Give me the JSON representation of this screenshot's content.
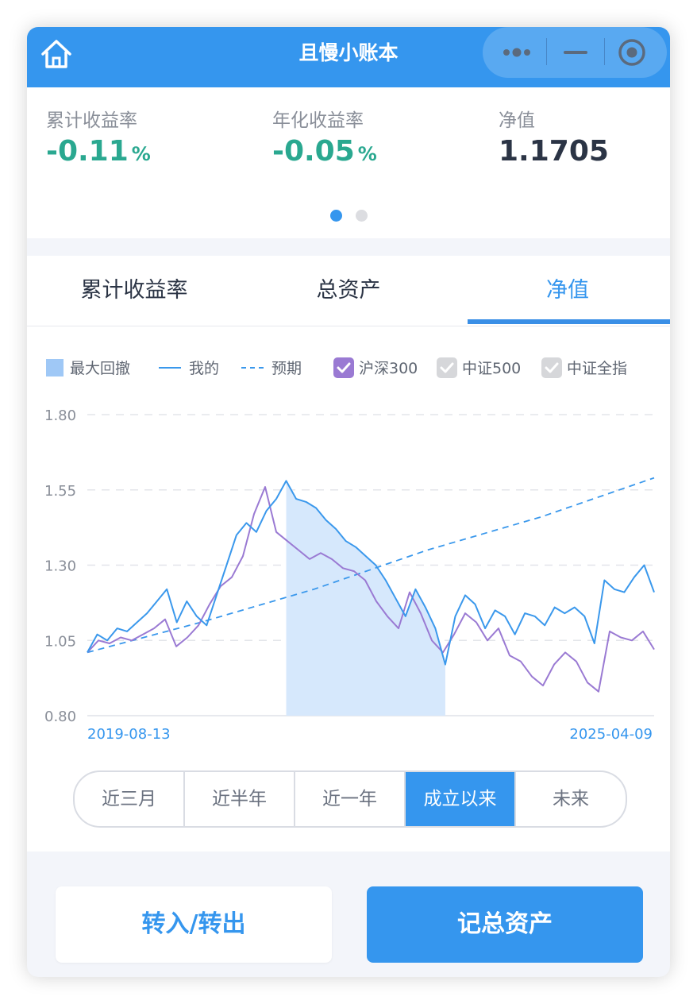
{
  "header": {
    "title": "且慢小账本",
    "home_icon": "home-icon",
    "menu_icons": [
      "more-dots-icon",
      "minimize-icon",
      "close-target-icon"
    ]
  },
  "stats": [
    {
      "label": "累计收益率",
      "value": "-0.11",
      "unit": "%",
      "color": "#2aa890"
    },
    {
      "label": "年化收益率",
      "value": "-0.05",
      "unit": "%",
      "color": "#2aa890"
    },
    {
      "label": "净值",
      "value": "1.1705",
      "unit": "",
      "color": "#2b3445"
    }
  ],
  "pager": {
    "pages": 2,
    "active": 0,
    "active_color": "#3596ee",
    "inactive_color": "#dcdde1"
  },
  "tabs": [
    {
      "label": "累计收益率",
      "active": false
    },
    {
      "label": "总资产",
      "active": false
    },
    {
      "label": "净值",
      "active": true
    }
  ],
  "legend": [
    {
      "label": "最大回撤",
      "kind": "area",
      "color": "#9fc8f6",
      "checked": true
    },
    {
      "label": "我的",
      "kind": "line",
      "color": "#3a98ec",
      "checked": true
    },
    {
      "label": "预期",
      "kind": "dashed",
      "color": "#3a98ec",
      "checked": true
    },
    {
      "label": "沪深300",
      "kind": "checkbox",
      "color": "#9a7ad3",
      "checked": true
    },
    {
      "label": "中证500",
      "kind": "checkbox",
      "color": "#d6d7da",
      "checked": false
    },
    {
      "label": "中证全指",
      "kind": "checkbox",
      "color": "#d6d7da",
      "checked": false
    }
  ],
  "chart_data": {
    "type": "line",
    "y_ticks": [
      "1.80",
      "1.55",
      "1.30",
      "1.05",
      "0.80"
    ],
    "ylim": [
      0.8,
      1.8
    ],
    "x_start_label": "2019-08-13",
    "x_end_label": "2025-04-09",
    "grid": true,
    "legend_position": "top",
    "series": [
      {
        "name": "我的",
        "color": "#3a98ec",
        "style": "solid",
        "values": [
          1.01,
          1.07,
          1.05,
          1.09,
          1.08,
          1.11,
          1.14,
          1.18,
          1.22,
          1.11,
          1.18,
          1.13,
          1.1,
          1.2,
          1.3,
          1.4,
          1.44,
          1.41,
          1.48,
          1.52,
          1.58,
          1.52,
          1.51,
          1.49,
          1.45,
          1.42,
          1.38,
          1.36,
          1.33,
          1.3,
          1.25,
          1.19,
          1.13,
          1.22,
          1.16,
          1.09,
          0.97,
          1.13,
          1.2,
          1.17,
          1.09,
          1.15,
          1.13,
          1.07,
          1.14,
          1.13,
          1.1,
          1.16,
          1.14,
          1.16,
          1.13,
          1.04,
          1.25,
          1.22,
          1.21,
          1.26,
          1.3,
          1.21
        ]
      },
      {
        "name": "沪深300",
        "color": "#9a7ad3",
        "style": "solid",
        "values": [
          1.01,
          1.05,
          1.04,
          1.06,
          1.05,
          1.07,
          1.09,
          1.12,
          1.03,
          1.06,
          1.1,
          1.17,
          1.23,
          1.26,
          1.33,
          1.47,
          1.56,
          1.41,
          1.38,
          1.35,
          1.32,
          1.34,
          1.32,
          1.29,
          1.28,
          1.25,
          1.18,
          1.13,
          1.09,
          1.21,
          1.14,
          1.05,
          1.01,
          1.07,
          1.14,
          1.11,
          1.05,
          1.09,
          1.0,
          0.98,
          0.93,
          0.9,
          0.97,
          1.01,
          0.98,
          0.91,
          0.88,
          1.08,
          1.06,
          1.05,
          1.08,
          1.02
        ]
      },
      {
        "name": "预期",
        "color": "#3a98ec",
        "style": "dashed",
        "values": [
          1.01,
          1.11,
          1.22,
          1.35,
          1.46,
          1.59
        ]
      }
    ],
    "drawdown": {
      "label": "最大回撤",
      "start_index_of_mine": 20,
      "end_index_of_mine": 36,
      "color": "#d6e8fc"
    }
  },
  "ranges": [
    {
      "label": "近三月",
      "active": false
    },
    {
      "label": "近半年",
      "active": false
    },
    {
      "label": "近一年",
      "active": false
    },
    {
      "label": "成立以来",
      "active": true
    },
    {
      "label": "未来",
      "active": false
    }
  ],
  "actions": {
    "transfer": "转入/转出",
    "record": "记总资产"
  }
}
